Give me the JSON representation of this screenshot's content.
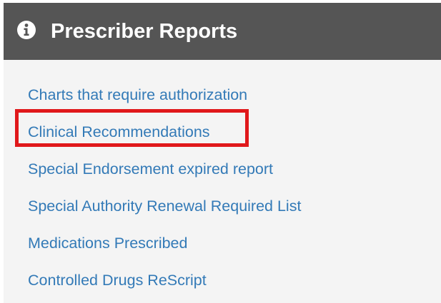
{
  "panel": {
    "title": "Prescriber Reports",
    "header_icon": "info-circle-icon",
    "header_color": "#555555",
    "body_color": "#f4f4f4",
    "link_color": "#337ab7"
  },
  "reports": [
    {
      "label": "Charts that require authorization"
    },
    {
      "label": "Clinical Recommendations",
      "highlighted": true
    },
    {
      "label": "Special Endorsement expired report"
    },
    {
      "label": "Special Authority Renewal Required List"
    },
    {
      "label": "Medications Prescribed"
    },
    {
      "label": "Controlled Drugs ReScript"
    }
  ],
  "highlight": {
    "color": "#e0181b",
    "target": "Clinical Recommendations"
  }
}
